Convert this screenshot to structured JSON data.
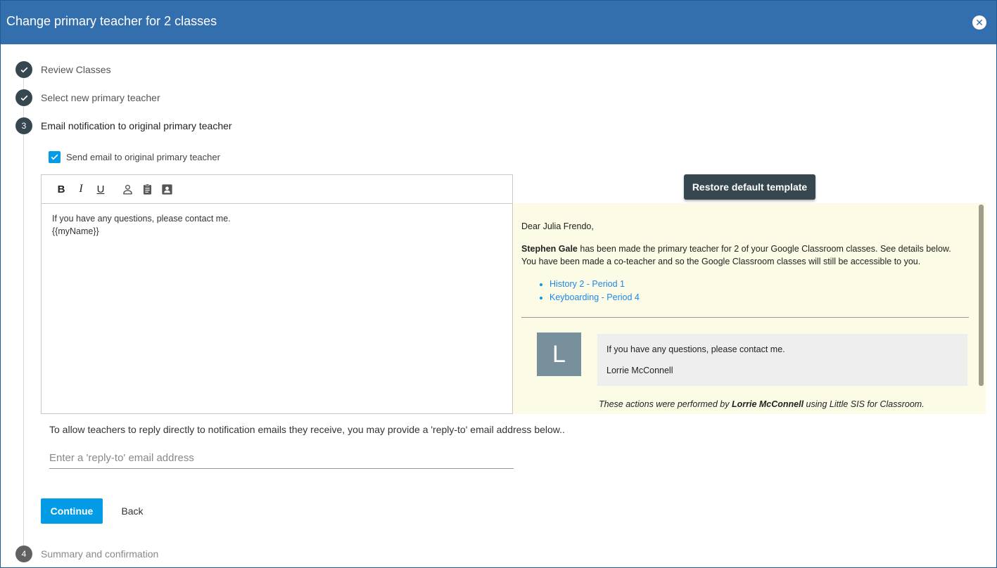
{
  "dialog": {
    "title": "Change primary teacher for 2 classes",
    "close_icon": "close-icon",
    "header_color": "#346fad"
  },
  "steps": [
    {
      "number": "1",
      "label": "Review Classes",
      "status": "done"
    },
    {
      "number": "2",
      "label": "Select new primary teacher",
      "status": "done"
    },
    {
      "number": "3",
      "label": "Email notification to original primary teacher",
      "status": "active"
    },
    {
      "number": "4",
      "label": "Summary and confirmation",
      "status": "pending"
    }
  ],
  "email": {
    "send_checkbox_label": "Send email to original primary teacher",
    "send_checked": true,
    "toolbar": {
      "bold": "B",
      "italic": "I",
      "underline": "U",
      "icons": [
        "person-icon",
        "clipboard-icon",
        "contact-card-icon"
      ]
    },
    "editor_lines": [
      "If you have any questions, please contact me.",
      "{{myName}}"
    ],
    "restore_button": "Restore default template"
  },
  "preview": {
    "greeting": "Dear Julia Frendo,",
    "new_teacher": "Stephen Gale",
    "body_line1": " has been made the primary teacher for 2 of your Google Classroom classes. See details below.",
    "body_line2": "You have been made a co-teacher and so the Google Classroom classes will still be accessible to you.",
    "classes": [
      "History 2 - Period 1",
      "Keyboarding - Period 4"
    ],
    "avatar_letter": "L",
    "signature_message": "If you have any questions, please contact me.",
    "signature_name": "Lorrie McConnell",
    "footer_prefix": "These actions were performed by ",
    "footer_actor": "Lorrie McConnell",
    "footer_suffix": " using Little SIS for Classroom.",
    "background_color": "#fcfbe5"
  },
  "reply_to": {
    "description": "To allow teachers to reply directly to notification emails they receive, you may provide a 'reply-to' email address below..",
    "placeholder": "Enter a 'reply-to' email address",
    "value": ""
  },
  "actions": {
    "continue": "Continue",
    "back": "Back",
    "accent_color": "#039be5"
  }
}
